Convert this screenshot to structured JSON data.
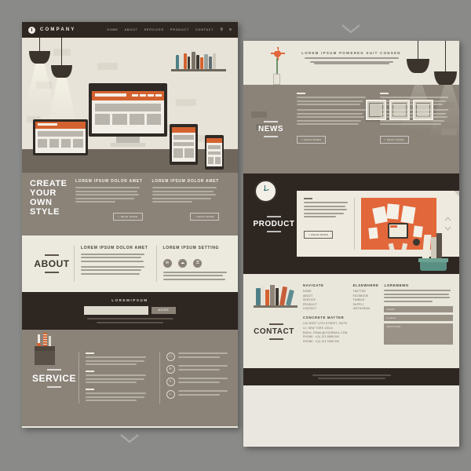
{
  "meta": {
    "canvas_bg": "#8a8a88",
    "dark_color": "#2e2620",
    "taupe_color": "#8b8378",
    "cream_color": "#eceadf",
    "accent_orange": "#d4622f"
  },
  "left_page": {
    "navbar": {
      "brand": "COMPANY",
      "logo_icon": "exclamation-circle-icon",
      "links": [
        "HOME",
        "ABOUT",
        "SERVICES",
        "PRODUCT",
        "CONTACT"
      ],
      "search_icon": "search-icon",
      "menu_icon": "hamburger-menu-icon"
    },
    "hero": {
      "illustration": "responsive-devices-workspace",
      "heading_lines": [
        "CREATE",
        "YOUR",
        "OWN",
        "STYLE"
      ],
      "columns": [
        {
          "title": "LOREM IPSUM DOLOR AMET",
          "body": "Lorem ipsum dolor sit amet, consectetur adipiscing elit. Donec fringilla nunc erat sed non eget turpis. Aenean in fringilla quis egestas nunc.",
          "button": "> READ MORE"
        },
        {
          "title": "LOREM IPSUM DOLOR AMET",
          "body": "Lorem ipsum dolor sit amet, consectetur adipiscing elit. Donec fringilla nunc erat sed non eget turpis. Aenean in fringilla quis egestas nunc.",
          "button": "> READ MORE"
        }
      ]
    },
    "about": {
      "label": "ABOUT",
      "columns": [
        {
          "title": "LOREM IPSUM DOLOR AMET",
          "body": "Lorem ipsum dolor sit amet, consectetur adipiscing elit. Donec fringilla nunc erat sed non eget turpis, sed ut elit odio."
        },
        {
          "title": "LOREM IPSUM SETTING",
          "body": "Lorem ipsum dolor sit amet, consectetur adipiscing elit. Donec fringilla nunc erat sed non eget turpis.",
          "icons": [
            "mail-icon",
            "chat-icon",
            "lock-icon"
          ]
        }
      ]
    },
    "subscribe": {
      "title": "LOREMIPSUM",
      "input_placeholder": "",
      "button": "MORE",
      "note": "Lorem ipsum dolor sit amet, consectetur adipiscing elit. Donec fringilla nunc ut turpis ut sodales."
    },
    "service": {
      "label": "SERVICE",
      "illustration": "pen-holder-desk-icon",
      "text_items": [
        "Lorem ipsum dolor sit amet, consectetur adipiscing elit. Donec fringilla sed sit quis.",
        "Lorem ipsum dolor sit amet, consectetur adipiscing elit. Donec fringilla sed sit quis.",
        "Lorem ipsum dolor sit amet, consectetur adipiscing elit. Donec fringilla sed sit quis."
      ],
      "feature_items": [
        {
          "icon": "monitor-icon",
          "text": "Lorem ipsum dolor sit amet, consectetur adipiscing elit."
        },
        {
          "icon": "gear-icon",
          "text": "Lorem ipsum dolor sit amet, consectetur adipiscing elit."
        },
        {
          "icon": "pencil-icon",
          "text": "Lorem ipsum dolor sit amet, consectetur adipiscing elit."
        },
        {
          "icon": "bulb-icon",
          "text": "Lorem ipsum dolor sit amet, consectetur adipiscing elit."
        }
      ]
    },
    "scroll_chevron": "chevron-down-icon"
  },
  "right_page": {
    "top_banner": {
      "title": "LOREM IPSUM POWERED SUIT CONSEN",
      "body": "Lorem ipsum dolor sit amet, consectetur adipiscing elit. Donec fringilla nunc erat viverra ut aliquet mattis. Aenean in fringilla quis hac beau. Mauris sit amet non.",
      "illustration": "flower-vase-and-pendant-lamps"
    },
    "news": {
      "label": "NEWS",
      "illustration": "three-picture-frames-on-brick-wall",
      "columns": [
        {
          "body": "Lorem ipsum dolor sit amet, consectetur adipiscing elit. Donec fringilla nunc erat sed non eget turpis, bed ut elit sodales. Lorem ipsum dolor sit amet, consectetur adipiscing elit.",
          "button": "> READ MORE"
        },
        {
          "body": "Lorem ipsum dolor sit amet, consectetur adipiscing elit. Donec fringilla nunc erat sed non eget turpis, bed ut elit sodales. Lorem ipsum dolor sit amet, consectetur adipiscing elit.",
          "button": "> READ MORE"
        }
      ]
    },
    "product": {
      "label": "PRODUCT",
      "clock_icon": "wall-clock-icon",
      "card": {
        "body": "Lorem ipsum dolor sit amet, consectetur adipiscing elit. Donec fringilla nunc erat sed non eget turpis.",
        "button": "> READ MORE",
        "image": "newspapers-and-tablet-flatlay"
      },
      "plant_icon": "potted-plant-icon"
    },
    "contact": {
      "label": "CONTACT",
      "illustration": "books-on-shelf-icon",
      "navigate": {
        "title": "NAVIGATE",
        "items": [
          "HOME",
          "ABOUT",
          "SERVICE",
          "PRODUCT",
          "CONTACT"
        ]
      },
      "elsewhere": {
        "title": "ELSEWHERE",
        "items": [
          "TWITTER",
          "FACEBOOK",
          "TUMBLR",
          "SUPPLY",
          "INSTAGRAM"
        ]
      },
      "concrete_matter": {
        "title": "CONCRETE MATTER",
        "lines": [
          "140 WEST 12TH STREET, SUITE",
          "12, NEW YORK 10014",
          "EMAIL: EMAIL@YOURMAIL.COM",
          "PHONE: +(0) 123 8888 000",
          "PHONE: +(0) 123 3489 000"
        ]
      },
      "form": {
        "title": "LOREMEMO",
        "body": "Lorem ipsum dolor sit amet, consectetur adipiscing elit. Donec fringilla nunc erat sed non eget turpis. Aenean in fringilla.",
        "fields": [
          {
            "label": "NAME",
            "value": ""
          },
          {
            "label": "E-MAIL",
            "value": ""
          },
          {
            "label": "MESSAGE",
            "value": ""
          }
        ]
      }
    },
    "copyright": "Lorem ipsum dolor sit amet, consectetur adipiscing elit. Donec fringilla nunc.",
    "scroll_chevron": "chevron-down-icon"
  }
}
